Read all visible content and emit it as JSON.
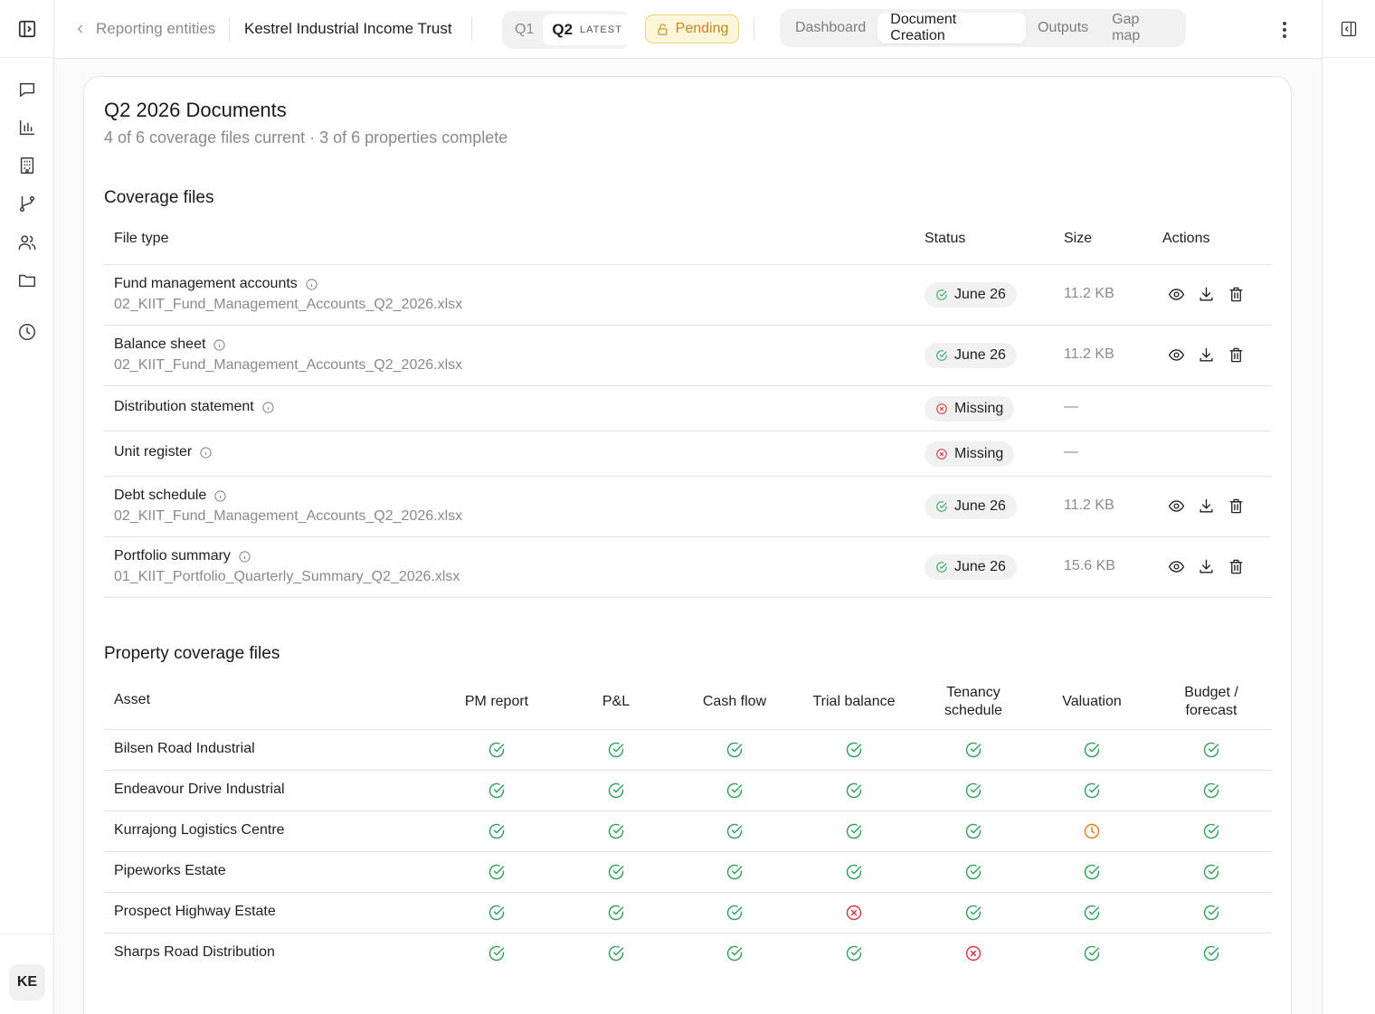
{
  "topbar": {
    "back_label": "Reporting entities",
    "entity_name": "Kestrel Industrial Income Trust",
    "quarters": [
      "Q1",
      "Q2"
    ],
    "active_quarter": "Q2",
    "latest_badge": "LATEST",
    "status_badge": "Pending",
    "tabs": [
      "Dashboard",
      "Document Creation",
      "Outputs",
      "Gap map"
    ],
    "active_tab": "Document Creation"
  },
  "sidebar": {
    "icons": [
      "panel-toggle-icon",
      "chat-icon",
      "bar-chart-icon",
      "building-icon",
      "branch-icon",
      "users-icon",
      "folder-icon",
      "clock-icon"
    ],
    "avatar": "KE"
  },
  "page": {
    "title": "Q2 2026 Documents",
    "subtitle": "4 of 6 coverage files current · 3 of 6 properties complete"
  },
  "coverage": {
    "title": "Coverage files",
    "headers": {
      "file_type": "File type",
      "status": "Status",
      "size": "Size",
      "actions": "Actions"
    },
    "rows": [
      {
        "label": "Fund management accounts",
        "file": "02_KIIT_Fund_Management_Accounts_Q2_2026.xlsx",
        "status": "June 26",
        "state": "ok",
        "size": "11.2 KB"
      },
      {
        "label": "Balance sheet",
        "file": "02_KIIT_Fund_Management_Accounts_Q2_2026.xlsx",
        "status": "June 26",
        "state": "ok",
        "size": "11.2 KB"
      },
      {
        "label": "Distribution statement",
        "file": "",
        "status": "Missing",
        "state": "missing",
        "size": "—"
      },
      {
        "label": "Unit register",
        "file": "",
        "status": "Missing",
        "state": "missing",
        "size": "—"
      },
      {
        "label": "Debt schedule",
        "file": "02_KIIT_Fund_Management_Accounts_Q2_2026.xlsx",
        "status": "June 26",
        "state": "ok",
        "size": "11.2 KB"
      },
      {
        "label": "Portfolio summary",
        "file": "01_KIIT_Portfolio_Quarterly_Summary_Q2_2026.xlsx",
        "status": "June 26",
        "state": "ok",
        "size": "15.6 KB"
      }
    ]
  },
  "property": {
    "title": "Property coverage files",
    "headers": {
      "asset": "Asset",
      "pm_report": "PM report",
      "pnl": "P&L",
      "cash_flow": "Cash flow",
      "trial_balance": "Trial balance",
      "tenancy_1": "Tenancy",
      "tenancy_2": "schedule",
      "valuation": "Valuation",
      "budget_1": "Budget /",
      "budget_2": "forecast"
    },
    "rows": [
      {
        "asset": "Bilsen Road Industrial",
        "cells": [
          "ok",
          "ok",
          "ok",
          "ok",
          "ok",
          "ok",
          "ok"
        ]
      },
      {
        "asset": "Endeavour Drive Industrial",
        "cells": [
          "ok",
          "ok",
          "ok",
          "ok",
          "ok",
          "ok",
          "ok"
        ]
      },
      {
        "asset": "Kurrajong Logistics Centre",
        "cells": [
          "ok",
          "ok",
          "ok",
          "ok",
          "ok",
          "pending",
          "ok"
        ]
      },
      {
        "asset": "Pipeworks Estate",
        "cells": [
          "ok",
          "ok",
          "ok",
          "ok",
          "ok",
          "ok",
          "ok"
        ]
      },
      {
        "asset": "Prospect Highway Estate",
        "cells": [
          "ok",
          "ok",
          "ok",
          "missing",
          "ok",
          "ok",
          "ok"
        ]
      },
      {
        "asset": "Sharps Road Distribution",
        "cells": [
          "ok",
          "ok",
          "ok",
          "ok",
          "missing",
          "ok",
          "ok"
        ]
      }
    ]
  },
  "colors": {
    "ok": "#2f9e5b",
    "missing": "#d8323a",
    "pending": "#e07b1a",
    "pending_badge_bg": "#fdf6d8",
    "pending_badge_text": "#c7861b"
  }
}
